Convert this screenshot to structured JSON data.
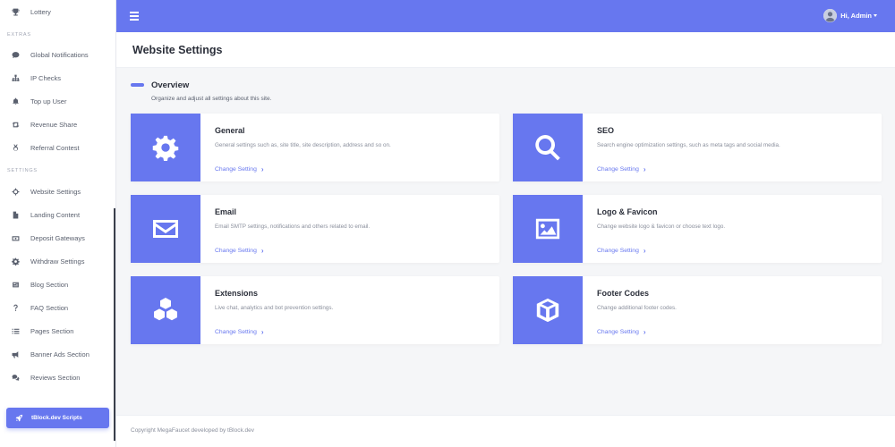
{
  "sidebar": {
    "top_item": {
      "label": "Lottery",
      "icon": "trophy-icon"
    },
    "sections": [
      {
        "title": "EXTRAS"
      },
      {
        "title": "SETTINGS"
      }
    ],
    "extras": [
      {
        "label": "Global Notifications",
        "icon": "comment-icon"
      },
      {
        "label": "IP Checks",
        "icon": "sitemap-icon"
      },
      {
        "label": "Top up User",
        "icon": "bell-icon"
      },
      {
        "label": "Revenue Share",
        "icon": "retweet-icon"
      },
      {
        "label": "Referral Contest",
        "icon": "award-icon"
      }
    ],
    "settings": [
      {
        "label": "Website Settings",
        "icon": "crosshair-icon"
      },
      {
        "label": "Landing Content",
        "icon": "file-icon"
      },
      {
        "label": "Deposit Gateways",
        "icon": "money-icon"
      },
      {
        "label": "Withdraw Settings",
        "icon": "gear-icon"
      },
      {
        "label": "Blog Section",
        "icon": "newspaper-icon"
      },
      {
        "label": "FAQ Section",
        "icon": "question-icon"
      },
      {
        "label": "Pages Section",
        "icon": "list-icon"
      },
      {
        "label": "Banner Ads Section",
        "icon": "bullhorn-icon"
      },
      {
        "label": "Reviews Section",
        "icon": "comments-icon"
      }
    ],
    "cta": {
      "label": "tBlock.dev Scripts",
      "icon": "rocket-icon"
    }
  },
  "topbar": {
    "user_label": "Hi, Admin"
  },
  "header": {
    "title": "Website Settings"
  },
  "overview": {
    "title": "Overview",
    "description": "Organize and adjust all settings about this site."
  },
  "cards": [
    {
      "title": "General",
      "description": "General settings such as, site title, site description, address and so on.",
      "link": "Change Setting",
      "icon": "gear-icon"
    },
    {
      "title": "SEO",
      "description": "Search engine optimization settings, such as meta tags and social media.",
      "link": "Change Setting",
      "icon": "search-icon"
    },
    {
      "title": "Email",
      "description": "Email SMTP settings, notifications and others related to email.",
      "link": "Change Setting",
      "icon": "envelope-icon"
    },
    {
      "title": "Logo & Favicon",
      "description": "Change website logo & favicon or choose text logo.",
      "link": "Change Setting",
      "icon": "image-icon"
    },
    {
      "title": "Extensions",
      "description": "Live chat, analytics and bot prevention settings.",
      "link": "Change Setting",
      "icon": "cubes-icon"
    },
    {
      "title": "Footer Codes",
      "description": "Change additional footer codes.",
      "link": "Change Setting",
      "icon": "cube-icon"
    }
  ],
  "footer": {
    "text": "Copyright MegaFaucet developed by tBlock.dev"
  },
  "colors": {
    "accent": "#6777ef",
    "sidebar_bg": "#ffffff",
    "page_bg": "#f5f6f8"
  }
}
